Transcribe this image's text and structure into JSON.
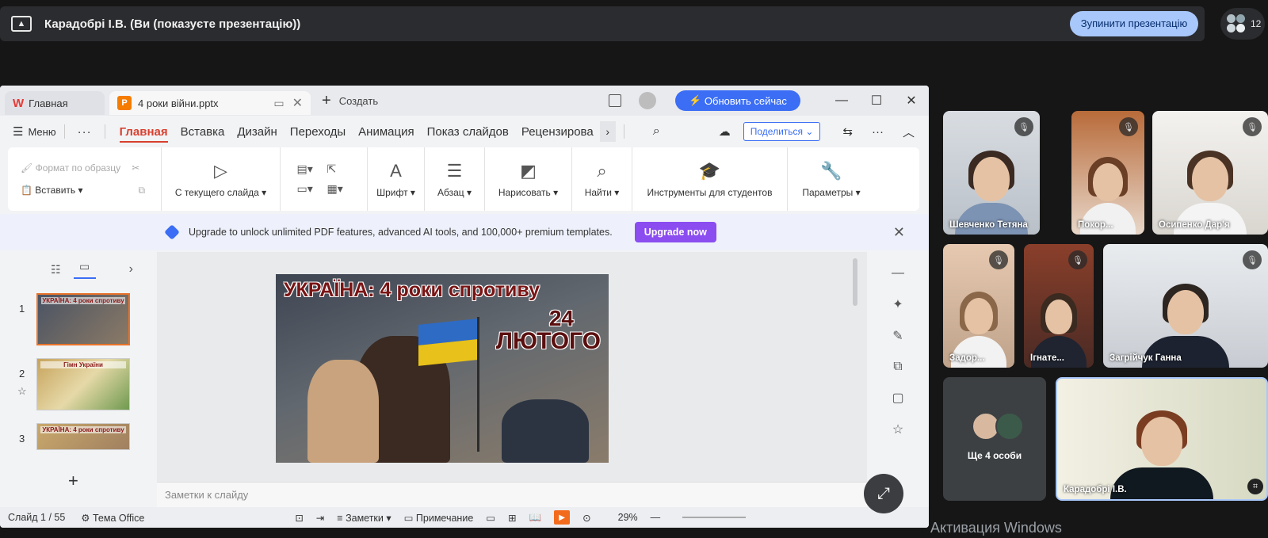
{
  "meet": {
    "presenter_title": "Карадобрі І.В. (Ви (показуєте презентацію))",
    "stop_button": "Зупинити презентацію",
    "participant_count": "12"
  },
  "wps": {
    "tabs": {
      "home": "Главная",
      "file": "4 роки війни.pptx",
      "new": "Создать"
    },
    "update_button": "Обновить сейчас",
    "menu": {
      "menu_label": "Меню",
      "items": [
        "Главная",
        "Вставка",
        "Дизайн",
        "Переходы",
        "Анимация",
        "Показ слайдов",
        "Рецензирова"
      ],
      "share": "Поделиться"
    },
    "ribbon": {
      "format_painter": "Формат по образцу",
      "paste": "Вставить",
      "from_current": "С текущего слайда",
      "font": "Шрифт",
      "paragraph": "Абзац",
      "draw": "Нарисовать",
      "find": "Найти",
      "student_tools": "Инструменты для студентов",
      "params": "Параметры"
    },
    "banner": {
      "text": "Upgrade to unlock unlimited PDF features, advanced AI tools, and 100,000+ premium templates.",
      "button": "Upgrade now"
    },
    "thumbnails": [
      {
        "num": "1",
        "title": "УКРАЇНА: 4 роки спротиву"
      },
      {
        "num": "2",
        "title": "Гімн України"
      },
      {
        "num": "3",
        "title": "УКРАЇНА: 4 роки спротиву"
      }
    ],
    "slide": {
      "title": "УКРАЇНА: 4 роки спротиву",
      "date_num": "24",
      "date_month": "ЛЮТОГО"
    },
    "notes_placeholder": "Заметки к слайду",
    "status": {
      "slide": "Слайд 1 / 55",
      "theme": "Тема Office",
      "notes": "Заметки",
      "comment": "Примечание",
      "zoom": "29%"
    }
  },
  "participants": [
    {
      "name": "Шевченко Тетяна",
      "hair": "#3b2a22",
      "shirt": "#7d93b3"
    },
    {
      "name": "Покор...",
      "hair": "#6a3f25",
      "shirt": "#f1f1f1"
    },
    {
      "name": "Осипенко Дар'я",
      "hair": "#4a3324",
      "shirt": "#f4f4f4"
    },
    {
      "name": "Задор...",
      "hair": "#8a6748",
      "shirt": "#f2f2f2"
    },
    {
      "name": "Ігнате...",
      "hair": "#3a2a20",
      "shirt": "#1f2430"
    },
    {
      "name": "Загрійчук Ганна",
      "hair": "#2d2520",
      "shirt": "#1c2230"
    },
    {
      "name": "Карадобрі І.В.",
      "hair": "#7a3d22",
      "shirt": "#101820"
    }
  ],
  "more_tile_label": "Ще 4 особи",
  "watermark": "Активация Windows"
}
